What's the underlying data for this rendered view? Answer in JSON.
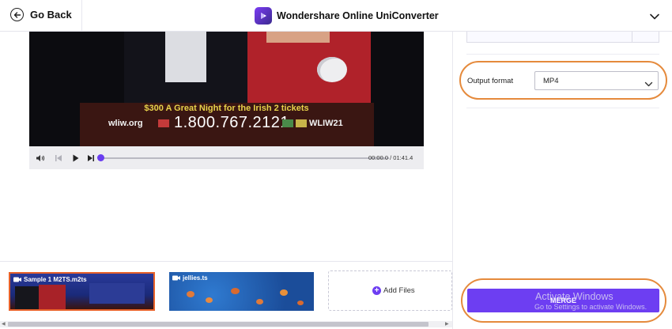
{
  "header": {
    "back_label": "Go Back",
    "brand_name": "Wondershare Online UniConverter"
  },
  "player": {
    "overlay_line1": "$300  A Great Night for the Irish 2 tickets",
    "overlay_site": "wliw.org",
    "overlay_phone": "1.800.767.2121",
    "overlay_station": "WLIW21",
    "time_display": "00:00.0 / 01:41.4",
    "progress": 0
  },
  "settings": {
    "format_label": "Output format",
    "format_value": "MP4"
  },
  "clips": [
    {
      "name": "Sample 1 M2TS.m2ts",
      "selected": true
    },
    {
      "name": "jellies.ts",
      "selected": false
    }
  ],
  "add_files_label": "Add Files",
  "merge_label": "MERGE",
  "watermark": {
    "title": "Activate Windows",
    "subtitle": "Go to Settings to activate Windows."
  },
  "colors": {
    "accent": "#6d3ef2",
    "highlight_oval": "#e58a3c",
    "selected_clip_border": "#e8622a"
  },
  "icons": [
    "back-arrow-icon",
    "app-logo-icon",
    "chevron-down-icon",
    "volume-icon",
    "skip-back-icon",
    "play-icon",
    "skip-forward-icon",
    "video-file-icon",
    "plus-icon"
  ]
}
